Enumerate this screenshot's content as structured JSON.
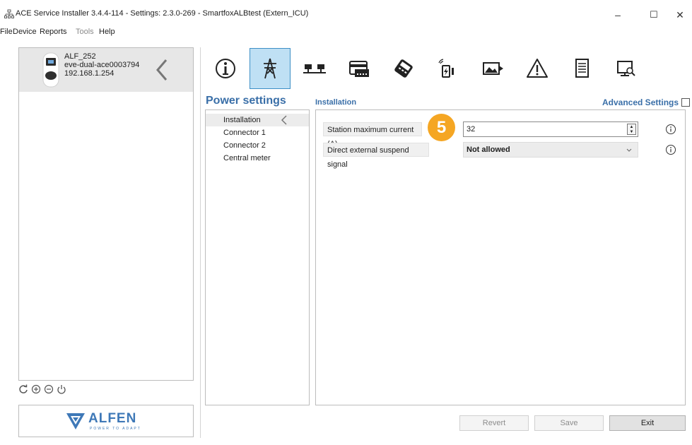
{
  "window": {
    "title": "ACE Service Installer 3.4.4-114 - Settings: 2.3.0-269 - SmartfoxALBtest (Extern_ICU)",
    "minimize": "–",
    "maximize": "☐",
    "close": "✕"
  },
  "menu": {
    "items": [
      "File",
      "Device",
      "Reports",
      "Tools",
      "Help"
    ]
  },
  "device": {
    "name": "ALF_252",
    "model": "eve-dual-ace0003794",
    "ip": "192.168.1.254"
  },
  "logo": {
    "brand": "ALFEN",
    "tagline": "POWER TO ADAPT"
  },
  "toolbar": {
    "icons": [
      "info-icon",
      "power-tower-icon",
      "connectors-icon",
      "card-reader-icon",
      "payment-icon",
      "charge-signal-icon",
      "display-image-icon",
      "warning-icon",
      "document-icon",
      "monitor-search-icon"
    ],
    "active": "power-tower-icon",
    "accent": "#3d8fc6"
  },
  "section": {
    "title": "Power settings",
    "subtitle": "Installation",
    "advanced_label": "Advanced Settings"
  },
  "nav": {
    "items": [
      "Installation",
      "Connector 1",
      "Connector 2",
      "Central meter"
    ],
    "active_index": 0
  },
  "fields": {
    "max_current_label": "Station maximum current (A)",
    "max_current_value": "32",
    "suspend_label": "Direct external suspend signal",
    "suspend_value": "Not allowed"
  },
  "badge": {
    "number": "5",
    "color": "#f5a623"
  },
  "buttons": {
    "revert": "Revert",
    "save": "Save",
    "exit": "Exit"
  }
}
